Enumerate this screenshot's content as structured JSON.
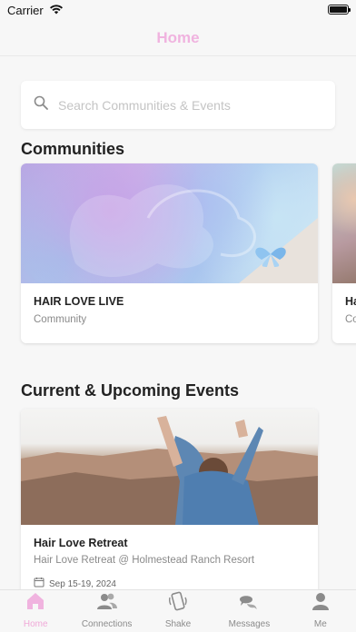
{
  "status_bar": {
    "carrier": "Carrier"
  },
  "nav": {
    "title": "Home"
  },
  "search": {
    "placeholder": "Search Communities & Events"
  },
  "communities": {
    "title": "Communities",
    "items": [
      {
        "title": "HAIR LOVE LIVE",
        "subtitle": "Community"
      },
      {
        "title": "Ha",
        "subtitle": "Co"
      }
    ]
  },
  "events": {
    "title": "Current & Upcoming Events",
    "items": [
      {
        "title": "Hair Love Retreat",
        "location": "Hair Love Retreat @ Holmestead Ranch Resort",
        "date": "Sep 15-19, 2024"
      }
    ]
  },
  "tabs": [
    {
      "label": "Home",
      "icon": "home-icon",
      "active": true
    },
    {
      "label": "Connections",
      "icon": "connections-icon",
      "active": false
    },
    {
      "label": "Shake",
      "icon": "shake-icon",
      "active": false
    },
    {
      "label": "Messages",
      "icon": "messages-icon",
      "active": false
    },
    {
      "label": "Me",
      "icon": "person-icon",
      "active": false
    }
  ],
  "colors": {
    "accent": "#f0a9d8",
    "inactive": "#8b8b8b",
    "background": "#f7f7f7"
  }
}
